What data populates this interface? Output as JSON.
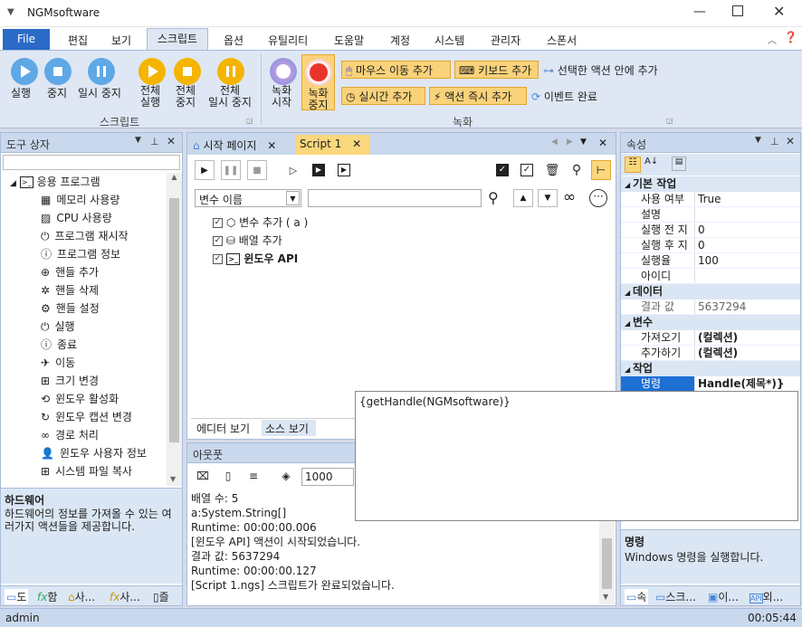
{
  "title": {
    "app": "NGMsoftware"
  },
  "ribbon_tabs": [
    "File",
    "편집",
    "보기",
    "스크립트",
    "옵션",
    "유틸리티",
    "도움말",
    "계정",
    "시스템",
    "관리자",
    "스폰서"
  ],
  "script_group": {
    "run": "실행",
    "stop": "중지",
    "pause": "일시 중지",
    "all_run": "전체\n실행",
    "all_stop": "전체\n중지",
    "all_pause": "전체\n일시 중지",
    "label": "스크립트"
  },
  "record_group": {
    "rec_start": "녹화\n시작",
    "rec_stop": "녹화\n중지",
    "mouse": "마우스 이동 추가",
    "keyboard": "키보드 추가",
    "selected": "선택한 액션 안에 추가",
    "realtime": "실시간 추가",
    "immediate": "액션 즉시 추가",
    "event": "이벤트 완료",
    "label": "녹화"
  },
  "toolbox": {
    "title": "도구 상자",
    "root": "응용 프로그램",
    "items": [
      "메모리 사용량",
      "CPU 사용량",
      "프로그램 재시작",
      "프로그램 정보",
      "핸들 추가",
      "핸들 삭제",
      "핸들 설정",
      "실행",
      "종료",
      "이동",
      "크기 변경",
      "윈도우 활성화",
      "윈도우 캡션 변경",
      "경로 처리",
      "윈도우 사용자 정보",
      "시스템 파일 복사"
    ],
    "desc_title": "하드웨어",
    "desc_text": "하드웨어의 정보를 가져올 수 있는 여러가지 액션들을 제공합니다.",
    "bottom_tabs": [
      "도",
      "함",
      "사...",
      "사...",
      "즐"
    ]
  },
  "doc_tabs": [
    "시작 페이지",
    "Script 1"
  ],
  "editor": {
    "var_select": "변수 이름",
    "tree": [
      "변수 추가 ( a )",
      "배열 추가",
      "윈도우 API"
    ],
    "tabs": [
      "에디터 보기",
      "소스 보기"
    ]
  },
  "output": {
    "title": "아웃풋",
    "input_value": "1000",
    "lines": [
      "배열 수: 5",
      "a:System.String[]",
      "Runtime: 00:00:00.006",
      "[윈도우 API] 액션이 시작되었습니다.",
      "결과 값: 5637294",
      "Runtime: 00:00:00.127",
      "[Script 1.ngs] 스크립트가 완료되었습니다."
    ]
  },
  "popup": {
    "text": "{getHandle(NGMsoftware)}"
  },
  "properties": {
    "title": "속성",
    "sections": [
      {
        "name": "기본 작업",
        "rows": [
          [
            "사용 여부",
            "True"
          ],
          [
            "설명",
            ""
          ],
          [
            "실행 전 지",
            "0"
          ],
          [
            "실행 후 지",
            "0"
          ],
          [
            "실행율",
            "100"
          ],
          [
            "아이디",
            ""
          ]
        ]
      },
      {
        "name": "데이터",
        "rows": [
          [
            "결과 값",
            "5637294"
          ]
        ]
      },
      {
        "name": "변수",
        "rows": [
          [
            "가져오기",
            "(컬렉션)"
          ],
          [
            "추가하기",
            "(컬렉션)"
          ]
        ]
      },
      {
        "name": "작업",
        "rows": [
          [
            "명령",
            "Handle(제목*)}"
          ]
        ]
      }
    ],
    "desc_title": "명령",
    "desc_text": "Windows 명령을 실행합니다.",
    "bottom_tabs": [
      "속",
      "스크...",
      "이...",
      "외..."
    ]
  },
  "status": {
    "user": "admin",
    "time": "00:05:44"
  }
}
